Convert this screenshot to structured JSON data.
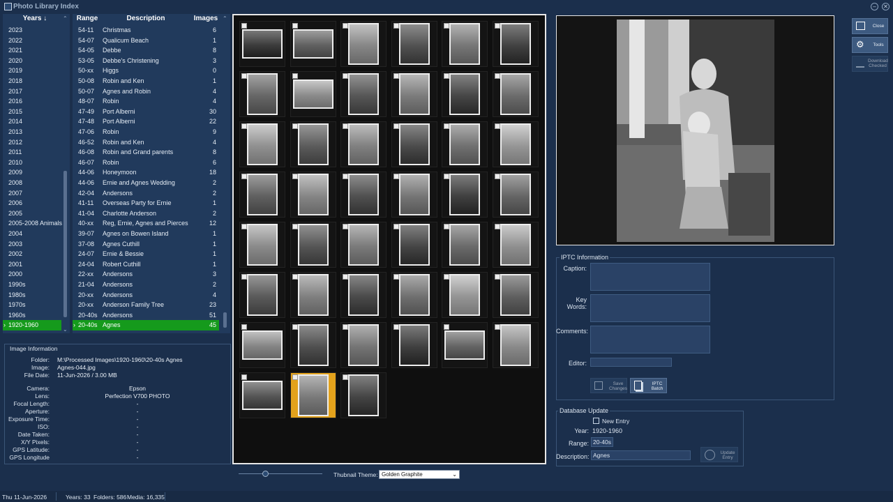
{
  "window": {
    "title": "Photo Library Index",
    "close_glyph": "✕",
    "minimize_glyph": "–"
  },
  "years": {
    "header": "Years ↓",
    "items": [
      "2023",
      "2022",
      "2021",
      "2020",
      "2019",
      "2018",
      "2017",
      "2016",
      "2015",
      "2014",
      "2013",
      "2012",
      "2011",
      "2010",
      "2009",
      "2008",
      "2007",
      "2006",
      "2005",
      "2005-2008 Animals",
      "2004",
      "2003",
      "2002",
      "2001",
      "2000",
      "1990s",
      "1980s",
      "1970s",
      "1960s",
      "1920-1960"
    ],
    "selected": "1920-1960"
  },
  "ranges": {
    "headers": [
      "Range",
      "Description",
      "Images"
    ],
    "rows": [
      [
        "54-11",
        "Christmas",
        "6"
      ],
      [
        "54-07",
        "Qualicum Beach",
        "1"
      ],
      [
        "54-05",
        "Debbe",
        "8"
      ],
      [
        "53-05",
        "Debbe's Christening",
        "3"
      ],
      [
        "50-xx",
        "Higgs",
        "0"
      ],
      [
        "50-08",
        "Robin and Ken",
        "1"
      ],
      [
        "50-07",
        "Agnes and Robin",
        "4"
      ],
      [
        "48-07",
        "Robin",
        "4"
      ],
      [
        "47-49",
        "Port Alberni",
        "30"
      ],
      [
        "47-48",
        "Port Alberni",
        "22"
      ],
      [
        "47-06",
        "Robin",
        "9"
      ],
      [
        "46-52",
        "Robin and Ken",
        "4"
      ],
      [
        "46-08",
        "Robin and Grand parents",
        "8"
      ],
      [
        "46-07",
        "Robin",
        "6"
      ],
      [
        "44-06",
        "Honeymoon",
        "18"
      ],
      [
        "44-06",
        "Ernie and Agnes Wedding",
        "2"
      ],
      [
        "42-04",
        "Andersons",
        "2"
      ],
      [
        "41-11",
        "Overseas Party for Ernie",
        "1"
      ],
      [
        "41-04",
        "Charlotte Anderson",
        "2"
      ],
      [
        "40-xx",
        "Reg, Ernie, Agnes and Pierces",
        "12"
      ],
      [
        "39-07",
        "Agnes on Bowen Island",
        "1"
      ],
      [
        "37-08",
        "Agnes Cuthill",
        "1"
      ],
      [
        "24-07",
        "Ernie & Bessie",
        "1"
      ],
      [
        "24-04",
        "Robert Cuthill",
        "1"
      ],
      [
        "22-xx",
        "Andersons",
        "3"
      ],
      [
        "21-04",
        "Andersons",
        "2"
      ],
      [
        "20-xx",
        "Andersons",
        "4"
      ],
      [
        "20-xx",
        "Anderson Family Tree",
        "23"
      ],
      [
        "20-40s",
        "Andersons",
        "51"
      ],
      [
        "20-40s",
        "Agnes",
        "45"
      ]
    ],
    "selected_index": 29
  },
  "image_info": {
    "title": "Image Information",
    "labels": [
      "Folder:",
      "Image:",
      "File Date:",
      "Camera:",
      "Lens:",
      "Focal Length:",
      "Aperture:",
      "Exposure Time:",
      "ISO:",
      "Date Taken:",
      "X/Y Pixels:",
      "GPS Latitude:",
      "GPS Longitude"
    ],
    "folder": "M:\\Processed Images\\1920-1960\\20-40s Agnes",
    "image": "Agnes-044.jpg",
    "file_date": "11-Jun-2026 / 3.00 MB",
    "camera": "Epson",
    "lens": "Perfection V700 PHOTO",
    "focal_length": "-",
    "aperture": "-",
    "exposure": "-",
    "iso": "-",
    "date_taken": "-",
    "xy_pixels": "-",
    "gps_lat": "-",
    "gps_lon": "-"
  },
  "thumbnails": {
    "count": 45,
    "selected_index": 43,
    "theme_label": "Thubnail Theme:",
    "theme_value": "Golden Graphite",
    "slider_level": 0.32
  },
  "iptc": {
    "title": "IPTC Information",
    "caption_label": "Caption:",
    "keywords_label": "Key Words:",
    "comments_label": "Comments:",
    "editor_label": "Editor:",
    "save_label": "Save Changes",
    "batch_label": "IPTC Batch"
  },
  "db_update": {
    "title": "Database Update",
    "new_entry_label": "New Entry",
    "year_label": "Year:",
    "year_value": "1920-1960",
    "range_label": "Range:",
    "range_value": "20-40s",
    "desc_label": "Description:",
    "desc_value": "Agnes",
    "update_label": "Update Entry"
  },
  "toolbar": {
    "close_label": "Close",
    "tools_label": "Tools",
    "download_label": "Download Checked"
  },
  "status": {
    "date": "Thu 11-Jun-2026",
    "years": "Years: 33",
    "folders": "Folders: 586",
    "media": "Media: 16,335"
  },
  "colors": {
    "background": "#1b2f4c",
    "panel": "#213a5c",
    "selection": "#159a1c",
    "thumb_selected": "#e3a21c"
  }
}
